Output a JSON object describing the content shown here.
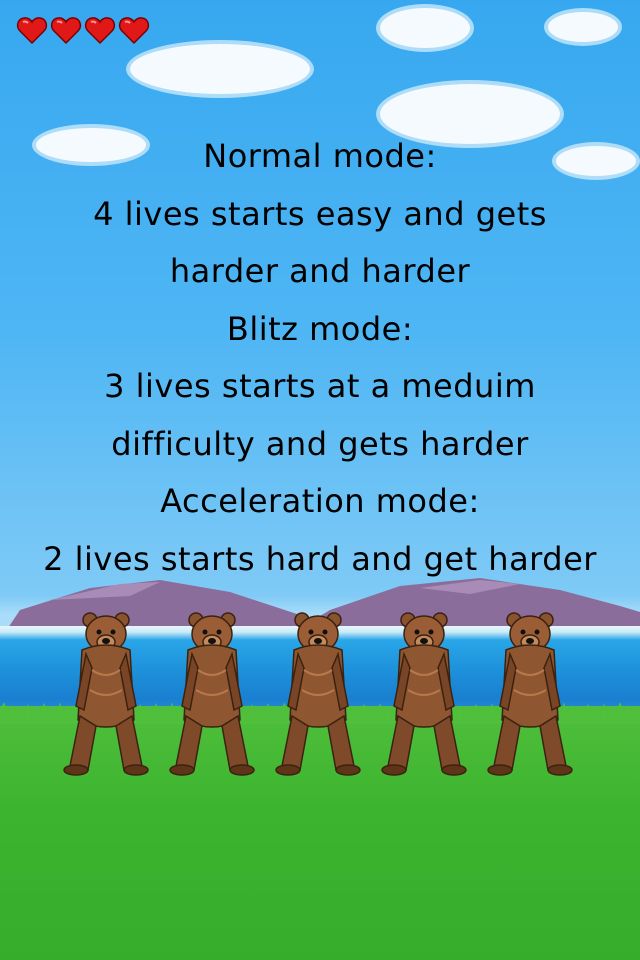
{
  "hud": {
    "lives": 4,
    "life_icon": "heart-icon",
    "life_color": "#e01818"
  },
  "instructions": {
    "lines": [
      "Normal mode:",
      "4 lives starts easy and gets",
      "harder and harder",
      "Blitz mode:",
      "3 lives starts at a meduim",
      "difficulty and gets harder",
      "Acceleration mode:",
      "2 lives starts hard and get harder"
    ]
  },
  "scene": {
    "bear_count": 5,
    "sky_color": "#3aa9f0",
    "grass_color": "#3db42f",
    "water_color": "#1e8fdc",
    "mountain_color": "#8a6a9a"
  }
}
